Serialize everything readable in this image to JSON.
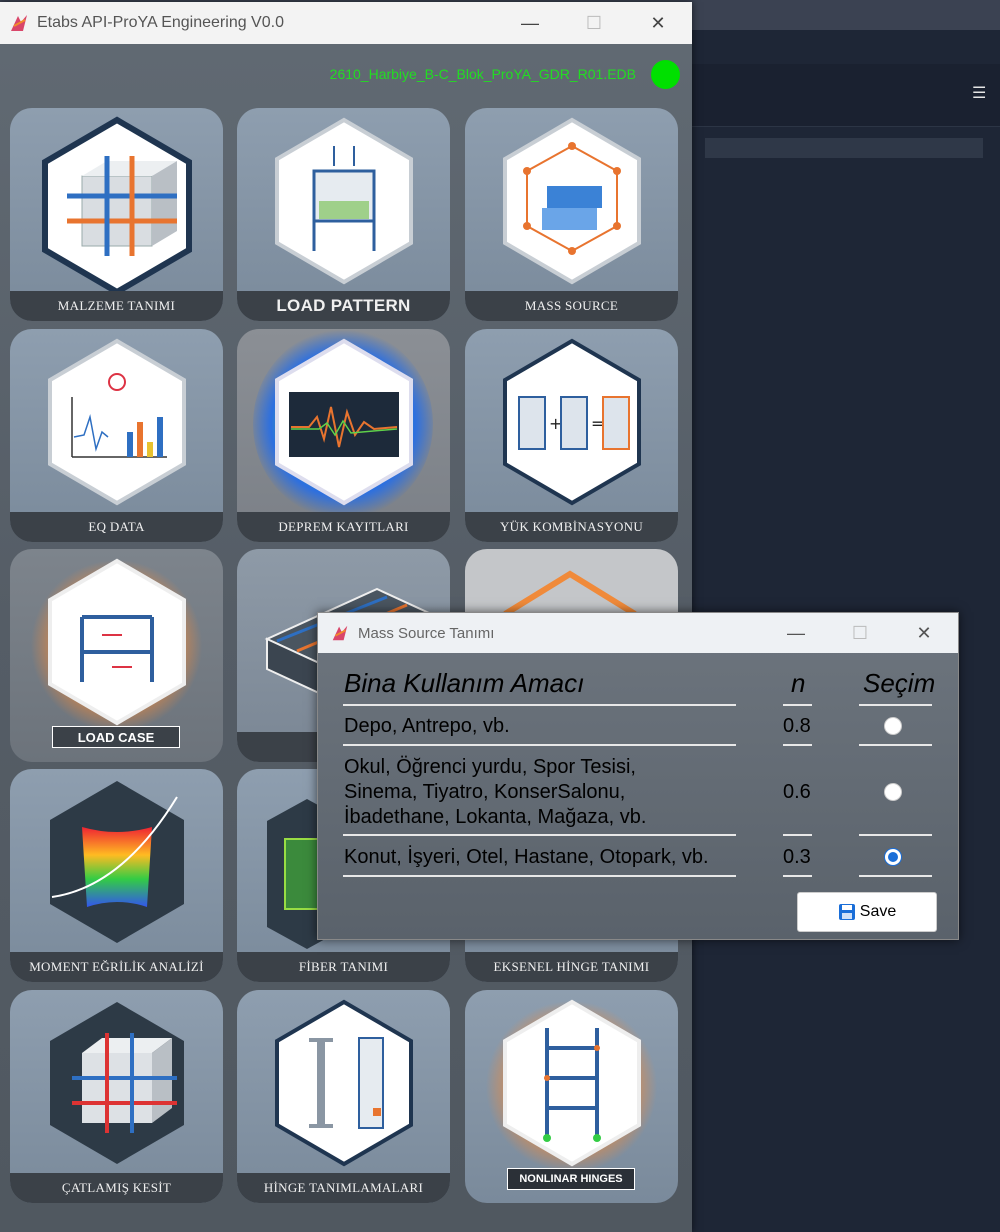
{
  "main_window": {
    "title": "Etabs API-ProYA Engineering V0.0",
    "file_name": "2610_Harbiye_B-C_Blok_ProYA_GDR_R01.EDB",
    "status_color": "#00e000",
    "controls": {
      "minimize": "—",
      "maximize": "☐",
      "close": "✕"
    }
  },
  "tiles": [
    {
      "label": "MALZEME TANIMI",
      "icon": "material-cube-icon"
    },
    {
      "label": "LOAD PATTERN",
      "icon": "load-pattern-frame-icon"
    },
    {
      "label": "MASS SOURCE",
      "icon": "mass-source-icon"
    },
    {
      "label": "EQ DATA",
      "icon": "eq-data-chart-icon"
    },
    {
      "label": "DEPREM KAYITLARI",
      "icon": "seismogram-icon"
    },
    {
      "label": "YÜK KOMBİNASYONU",
      "icon": "load-combination-icon"
    },
    {
      "label": "LOAD CASE",
      "icon": "load-case-frame-icon"
    },
    {
      "label": "KE",
      "icon": "rebar-beam-icon"
    },
    {
      "label": "",
      "icon": "hidden-tile-icon"
    },
    {
      "label": "MOMENT EĞRİLİK ANALİZİ",
      "icon": "moment-curvature-icon"
    },
    {
      "label": "FİBER TANIMI",
      "icon": "fiber-section-icon"
    },
    {
      "label": "EKSENEL HİNGE TANIMI",
      "icon": "axial-hinge-icon"
    },
    {
      "label": "ÇATLAMIŞ KESİT",
      "icon": "cracked-section-icon"
    },
    {
      "label": "HİNGE TANIMLAMALARI",
      "icon": "hinge-definition-icon"
    },
    {
      "label": "NONLINAR HINGES",
      "icon": "nonlinear-hinges-icon"
    }
  ],
  "dialog": {
    "title": "Mass Source Tanımı",
    "controls": {
      "minimize": "—",
      "maximize": "☐",
      "close": "✕"
    },
    "headers": {
      "usage": "Bina Kullanım Amacı",
      "n": "n",
      "selection": "Seçim"
    },
    "rows": [
      {
        "usage": "Depo, Antrepo, vb.",
        "n": "0.8",
        "selected": false
      },
      {
        "usage_lines": [
          "Okul, Öğrenci yurdu, Spor Tesisi,",
          "Sinema, Tiyatro, KonserSalonu,",
          "İbadethane, Lokanta, Mağaza, vb."
        ],
        "n": "0.6",
        "selected": false
      },
      {
        "usage": "Konut, İşyeri, Otel, Hastane, Otopark, vb.",
        "n": "0.3",
        "selected": true
      }
    ],
    "save_label": "Save",
    "accent_color": "#1a6ed8"
  }
}
